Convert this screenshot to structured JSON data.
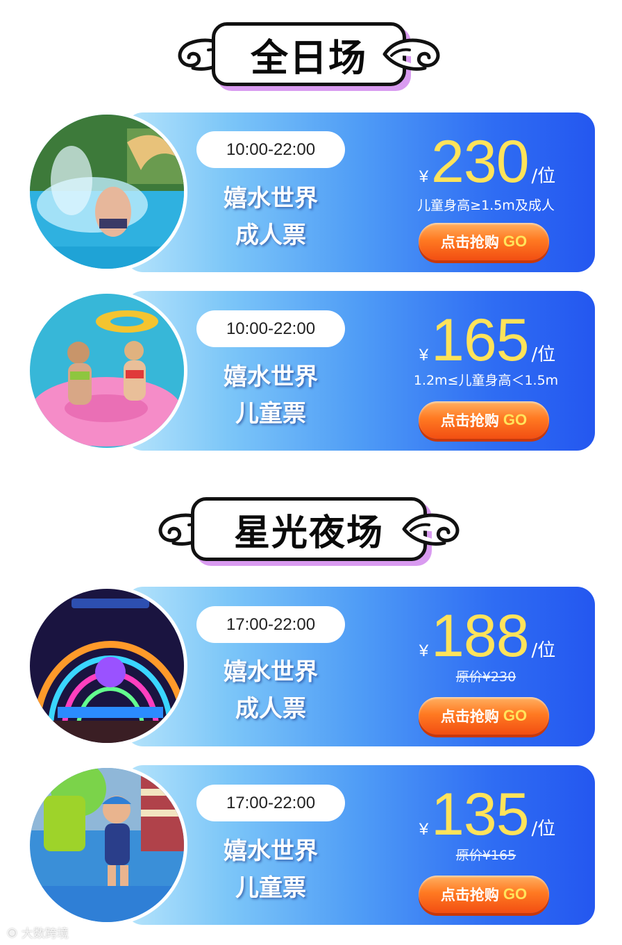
{
  "sections": [
    {
      "title": "全日场",
      "tickets": [
        {
          "time": "10:00-22:00",
          "name_line1": "嬉水世界",
          "name_line2": "成人票",
          "currency": "¥",
          "price": "230",
          "unit": "/位",
          "note": "儿童身高≥1.5m及成人",
          "note_strike": false,
          "button_label": "点击抢购",
          "button_go": "GO",
          "photo": "water-splash-photo"
        },
        {
          "time": "10:00-22:00",
          "name_line1": "嬉水世界",
          "name_line2": "儿童票",
          "currency": "¥",
          "price": "165",
          "unit": "/位",
          "note": "1.2m≤儿童身高＜1.5m",
          "note_strike": false,
          "button_label": "点击抢购",
          "button_go": "GO",
          "photo": "pool-float-photo"
        }
      ]
    },
    {
      "title": "星光夜场",
      "tickets": [
        {
          "time": "17:00-22:00",
          "name_line1": "嬉水世界",
          "name_line2": "成人票",
          "currency": "¥",
          "price": "188",
          "unit": "/位",
          "note": "原价¥230",
          "note_strike": true,
          "button_label": "点击抢购",
          "button_go": "GO",
          "photo": "night-stage-photo"
        },
        {
          "time": "17:00-22:00",
          "name_line1": "嬉水世界",
          "name_line2": "儿童票",
          "currency": "¥",
          "price": "135",
          "unit": "/位",
          "note": "原价¥165",
          "note_strike": true,
          "button_label": "点击抢购",
          "button_go": "GO",
          "photo": "kid-in-water-photo"
        }
      ]
    }
  ],
  "watermark": "大数跨境",
  "colors": {
    "price": "#ffe35a",
    "card_gradient_start": "#b6e4fb",
    "card_gradient_end": "#2457f0",
    "button": "#ff7a22",
    "banner_shadow": "#d99bf0"
  }
}
